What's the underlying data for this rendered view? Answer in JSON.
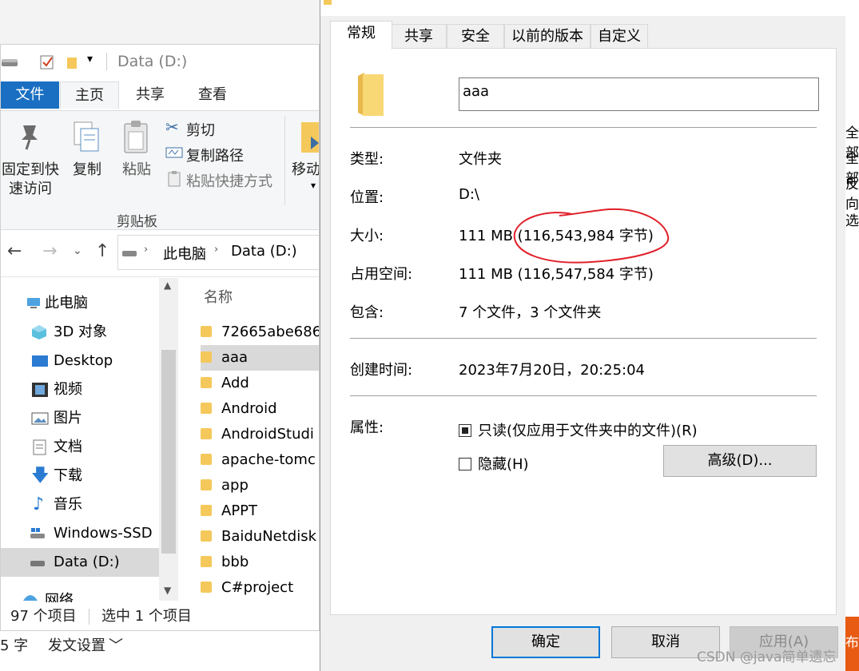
{
  "explorer": {
    "title": "Data (D:)",
    "tabs": {
      "file": "文件",
      "home": "主页",
      "share": "共享",
      "view": "查看"
    },
    "ribbon": {
      "pin_line1": "固定到快",
      "pin_line2": "速访问",
      "copy": "复制",
      "paste": "粘贴",
      "cut": "剪切",
      "copy_path": "复制路径",
      "paste_shortcut": "粘贴快捷方式",
      "move": "移动",
      "clipboard_group": "剪贴板"
    },
    "address": {
      "this_pc": "此电脑",
      "drive": "Data (D:)"
    },
    "tree": {
      "this_pc": "此电脑",
      "objects3d": "3D 对象",
      "desktop": "Desktop",
      "videos": "视频",
      "pictures": "图片",
      "documents": "文档",
      "downloads": "下载",
      "music": "音乐",
      "windows_ssd": "Windows-SSD (",
      "data_drive": "Data (D:)",
      "network": "网络"
    },
    "column_name": "名称",
    "files": [
      "72665abe686",
      "aaa",
      "Add",
      "Android",
      "AndroidStudi",
      "apache-tomc",
      "app",
      "APPT",
      "BaiduNetdisk",
      "bbb",
      "C#project"
    ],
    "status": {
      "count": "97 个项目",
      "selected": "选中 1 个项目"
    }
  },
  "background": {
    "word_count_fragment": "5 字",
    "publish_settings": "发文设置"
  },
  "dialog": {
    "tabs": {
      "general": "常规",
      "share": "共享",
      "security": "安全",
      "previous": "以前的版本",
      "custom": "自定义"
    },
    "name_value": "aaa",
    "labels": {
      "type": "类型:",
      "location": "位置:",
      "size": "大小:",
      "size_on_disk": "占用空间:",
      "contains": "包含:",
      "created": "创建时间:",
      "attributes": "属性:"
    },
    "values": {
      "type": "文件夹",
      "location": "D:\\",
      "size": "111 MB (116,543,984 字节)",
      "size_on_disk": "111 MB (116,547,584 字节)",
      "contains": "7 个文件，3 个文件夹",
      "created": "2023年7月20日，20:25:04"
    },
    "readonly_label": "只读(仅应用于文件夹中的文件)(R)",
    "hidden_label": "隐藏(H)",
    "advanced_button": "高级(D)...",
    "ok_button": "确定",
    "cancel_button": "取消",
    "apply_button": "应用(A)"
  },
  "right_edge": {
    "frag1": "全部",
    "frag2": "全部",
    "frag3": "反向",
    "frag4": "选",
    "frag5": "布"
  },
  "watermark": "CSDN @java简单遗忘",
  "colors": {
    "accent": "#1a6fc2",
    "annotation": "#e0202a",
    "selection": "#d9d9d9"
  }
}
